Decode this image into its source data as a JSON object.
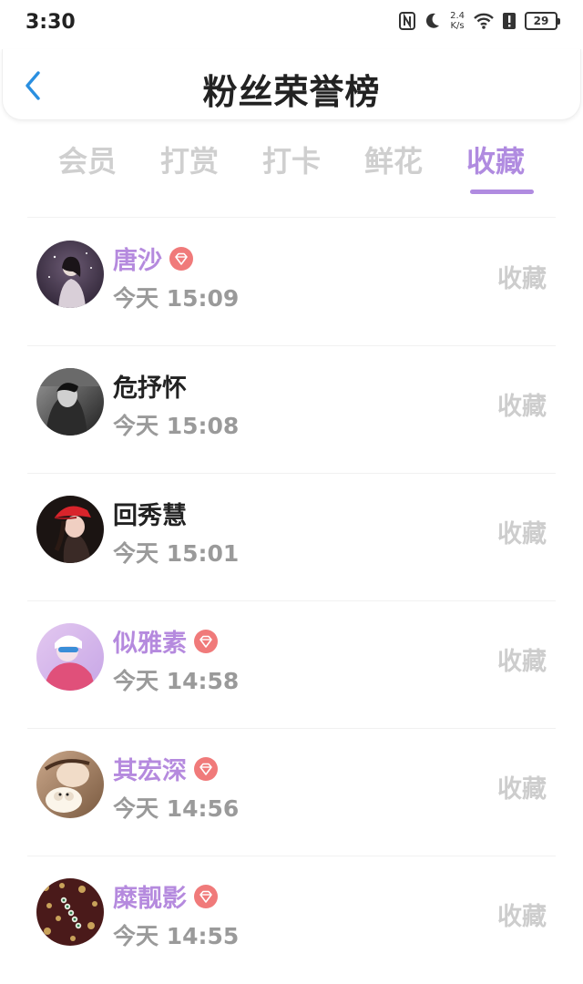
{
  "status_bar": {
    "time": "3:30",
    "net_speed_value": "2.4",
    "net_speed_unit": "K/s",
    "battery": "29",
    "icons": [
      "nfc-icon",
      "moon-icon",
      "wifi-icon",
      "alert-icon",
      "battery-icon"
    ]
  },
  "header": {
    "title": "粉丝荣誉榜",
    "back_icon": "chevron-left-icon"
  },
  "tabs": [
    {
      "label": "会员",
      "active": false
    },
    {
      "label": "打赏",
      "active": false
    },
    {
      "label": "打卡",
      "active": false
    },
    {
      "label": "鲜花",
      "active": false
    },
    {
      "label": "收藏",
      "active": true
    }
  ],
  "colors": {
    "accent": "#b08be0",
    "vip_name": "#b58ade",
    "badge": "#f07a7a",
    "back_icon": "#2a8fe0"
  },
  "list": [
    {
      "name": "唐沙",
      "vip": true,
      "time": "今天 15:09",
      "action": "收藏"
    },
    {
      "name": "危抒怀",
      "vip": false,
      "time": "今天 15:08",
      "action": "收藏"
    },
    {
      "name": "回秀慧",
      "vip": false,
      "time": "今天 15:01",
      "action": "收藏"
    },
    {
      "name": "似雅素",
      "vip": true,
      "time": "今天 14:58",
      "action": "收藏"
    },
    {
      "name": "其宏深",
      "vip": true,
      "time": "今天 14:56",
      "action": "收藏"
    },
    {
      "name": "糜靓影",
      "vip": true,
      "time": "今天 14:55",
      "action": "收藏"
    }
  ]
}
